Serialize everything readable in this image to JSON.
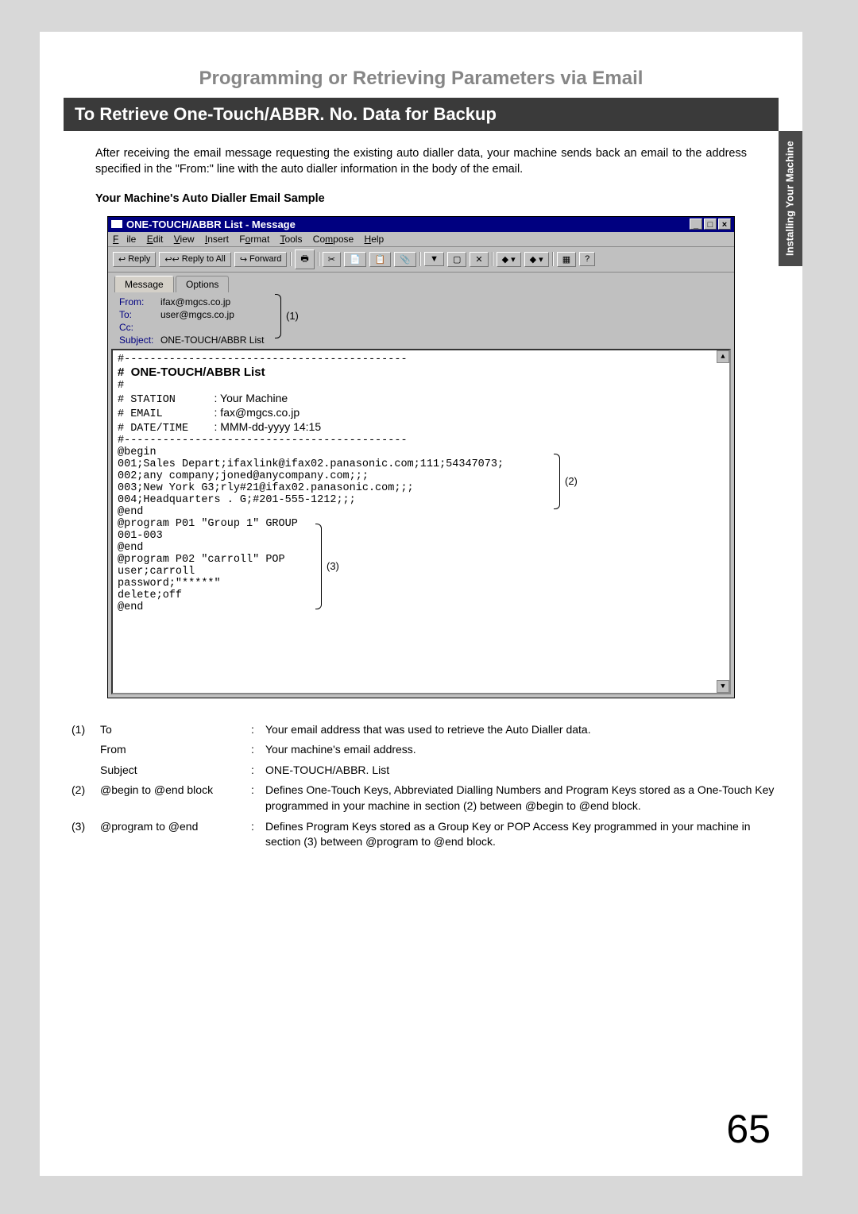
{
  "sidebar_label": "Installing Your\nMachine",
  "section_title": "Programming or Retrieving Parameters via Email",
  "subsection_title": "To Retrieve One-Touch/ABBR. No. Data for Backup",
  "paragraph": "After receiving the email message requesting the existing auto dialler data, your machine sends back an email to the address specified in the \"From:\" line with the auto dialler information in the body of the email.",
  "sample_label": "Your Machine's Auto Dialler Email Sample",
  "window": {
    "title": "ONE-TOUCH/ABBR List - Message",
    "minimize": "_",
    "restore": "□",
    "close": "×",
    "menu": {
      "file": "File",
      "edit": "Edit",
      "view": "View",
      "insert": "Insert",
      "format": "Format",
      "tools": "Tools",
      "compose": "Compose",
      "help": "Help"
    },
    "toolbar": {
      "reply": "Reply",
      "replyall": "Reply to All",
      "forward": "Forward"
    },
    "tabs": {
      "message": "Message",
      "options": "Options"
    },
    "headers": {
      "from_label": "From:",
      "from_val": "ifax@mgcs.co.jp",
      "to_label": "To:",
      "to_val": "user@mgcs.co.jp",
      "cc_label": "Cc:",
      "cc_val": "",
      "subject_label": "Subject:",
      "subject_val": "ONE-TOUCH/ABBR List"
    },
    "annot1": "(1)",
    "body": {
      "divider1": "#--------------------------------------------",
      "title_line": "#  ONE-TOUCH/ABBR List",
      "hash": "#",
      "station_label": "# STATION",
      "station_val": ": Your Machine",
      "email_label": "# EMAIL",
      "email_val": ": fax@mgcs.co.jp",
      "date_label": "# DATE/TIME",
      "date_val": ": MMM-dd-yyyy 14:15",
      "divider2": "#--------------------------------------------",
      "begin": "@begin",
      "l1": "001;Sales Depart;ifaxlink@ifax02.panasonic.com;111;54347073;",
      "l2": "002;any company;joned@anycompany.com;;;",
      "l3": "003;New York G3;rly#21@ifax02.panasonic.com;;;",
      "l4": "004;Headquarters . G;#201-555-1212;;;",
      "end1": "@end",
      "p1": "@program P01 \"Group 1\" GROUP",
      "p1a": "001-003",
      "end2": "@end",
      "p2": "@program P02 \"carroll\" POP",
      "p2a": "user;carroll",
      "p2b": "password;\"*****\"",
      "p2c": "delete;off",
      "end3": "@end"
    },
    "annot2": "(2)",
    "annot3": "(3)"
  },
  "legend": [
    {
      "n": "(1)",
      "k": "To",
      "c": ":",
      "d": "Your email address that was used to retrieve the Auto Dialler data."
    },
    {
      "n": "",
      "k": "From",
      "c": ":",
      "d": "Your machine's email address."
    },
    {
      "n": "",
      "k": "Subject",
      "c": ":",
      "d": "ONE-TOUCH/ABBR. List"
    },
    {
      "n": "(2)",
      "k": "@begin to @end block",
      "c": ":",
      "d": "Defines One-Touch Keys, Abbreviated Dialling Numbers and Program Keys stored as a One-Touch Key programmed in your machine in section (2) between @begin to @end block."
    },
    {
      "n": "(3)",
      "k": "@program to @end",
      "c": ":",
      "d": "Defines Program Keys stored as a Group Key or POP Access Key programmed in your machine in section (3) between @program to @end block."
    }
  ],
  "page_number": "65"
}
